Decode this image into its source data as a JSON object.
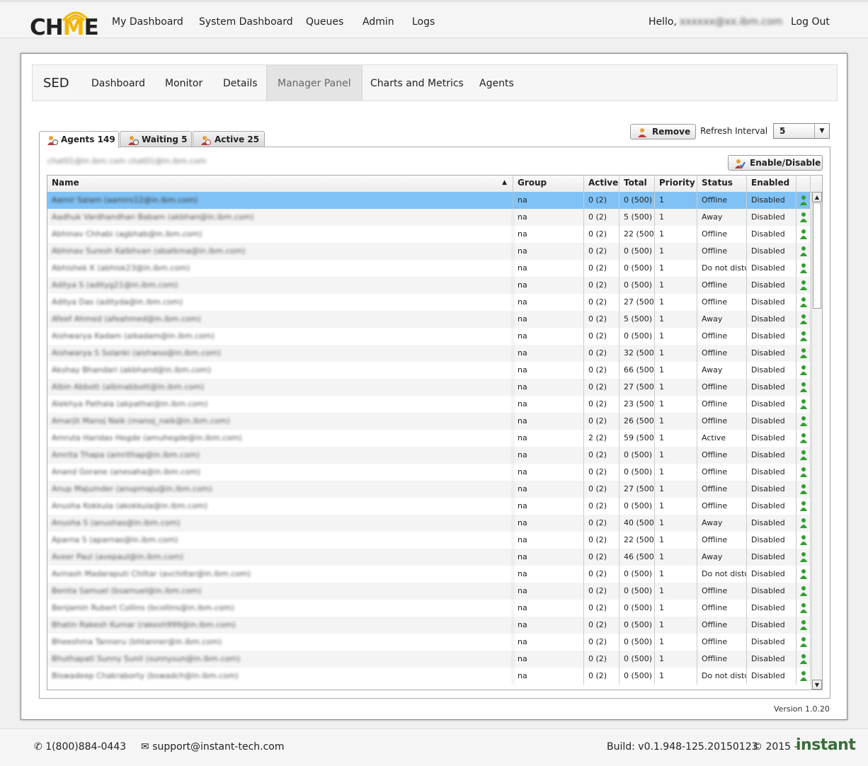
{
  "app": {
    "logo_text_pre": "CH",
    "logo_text_m": "M",
    "logo_text_post": "E"
  },
  "topnav": {
    "items": [
      "My Dashboard",
      "System Dashboard",
      "Queues",
      "Admin",
      "Logs"
    ],
    "hello": "Hello,",
    "user": "xxxxxx@xx.ibm.com",
    "logout": "Log Out"
  },
  "subnav": {
    "brand": "SED",
    "items": [
      "Dashboard",
      "Monitor",
      "Details",
      "Manager Panel",
      "Charts and Metrics",
      "Agents"
    ],
    "active": "Manager Panel"
  },
  "tabs": [
    {
      "label": "Agents 149",
      "icon": "agent-icon"
    },
    {
      "label": "Waiting 5",
      "icon": "waiting-icon"
    },
    {
      "label": "Active 25",
      "icon": "active-icon"
    }
  ],
  "toolbar": {
    "remove": "Remove",
    "refresh_label": "Refresh Interval",
    "refresh_value": "5",
    "enable_disable": "Enable/Disable"
  },
  "emails_line": "chat01@in.ibm.com chat01@in.ibm.com",
  "table": {
    "columns": [
      "Name",
      "Group",
      "Active",
      "Total",
      "Priority",
      "Status",
      "Enabled"
    ],
    "rows": [
      [
        "Aamir Salam (aamirs12@in.ibm.com)",
        "na",
        "0 (2)",
        "0 (500)",
        "1",
        "Offline",
        "Disabled"
      ],
      [
        "Aadhuk Vardhandhan Babam (akbhan@in.ibm.com)",
        "na",
        "0 (2)",
        "5 (500)",
        "1",
        "Away",
        "Disabled"
      ],
      [
        "Abhinav Chhabi (agbhab@in.ibm.com)",
        "na",
        "0 (2)",
        "22 (500)",
        "1",
        "Offline",
        "Disabled"
      ],
      [
        "Abhinav Suresh Kalbhvan (abatkma@in.ibm.com)",
        "na",
        "0 (2)",
        "0 (500)",
        "1",
        "Offline",
        "Disabled"
      ],
      [
        "Abhishek K (abhisk23@in.ibm.com)",
        "na",
        "0 (2)",
        "0 (500)",
        "1",
        "Do not distu",
        "Disabled"
      ],
      [
        "Aditya S (adityg21@in.ibm.com)",
        "na",
        "0 (2)",
        "0 (500)",
        "1",
        "Offline",
        "Disabled"
      ],
      [
        "Aditya Das (adityda@in.ibm.com)",
        "na",
        "0 (2)",
        "27 (500)",
        "1",
        "Offline",
        "Disabled"
      ],
      [
        "Afeef Ahmed (afeahmed@in.ibm.com)",
        "na",
        "0 (2)",
        "5 (500)",
        "1",
        "Away",
        "Disabled"
      ],
      [
        "Aishwarya Kadam (aikadam@in.ibm.com)",
        "na",
        "0 (2)",
        "0 (500)",
        "1",
        "Offline",
        "Disabled"
      ],
      [
        "Aishwarya S Solanki (aishwso@in.ibm.com)",
        "na",
        "0 (2)",
        "32 (500",
        "1",
        "Offline",
        "Disabled"
      ],
      [
        "Akshay Bhandari (akbhand@in.ibm.com)",
        "na",
        "0 (2)",
        "66 (500",
        "1",
        "Away",
        "Disabled"
      ],
      [
        "Albin Abbott (albinabbott@in.ibm.com)",
        "na",
        "0 (2)",
        "27 (500)",
        "1",
        "Offline",
        "Disabled"
      ],
      [
        "Alekhya Pathala (akpathal@in.ibm.com)",
        "na",
        "0 (2)",
        "23 (500",
        "1",
        "Offline",
        "Disabled"
      ],
      [
        "Amarjit Manoj Naik (manoj_naik@in.ibm.com)",
        "na",
        "0 (2)",
        "26 (500",
        "1",
        "Offline",
        "Disabled"
      ],
      [
        "Amruta Haridas Hegde (amuhegde@in.ibm.com)",
        "na",
        "2 (2)",
        "59 (500",
        "1",
        "Active",
        "Disabled"
      ],
      [
        "Amrita Thapa (amrithap@in.ibm.com)",
        "na",
        "0 (2)",
        "0 (500)",
        "1",
        "Offline",
        "Disabled"
      ],
      [
        "Anand Gorane (anesaha@in.ibm.com)",
        "na",
        "0 (2)",
        "0 (500)",
        "1",
        "Offline",
        "Disabled"
      ],
      [
        "Anup Majumder (anupmaju@in.ibm.com)",
        "na",
        "0 (2)",
        "27 (500)",
        "1",
        "Offline",
        "Disabled"
      ],
      [
        "Anusha Kokkula (akokkula@in.ibm.com)",
        "na",
        "0 (2)",
        "0 (500)",
        "1",
        "Offline",
        "Disabled"
      ],
      [
        "Anusha S (anushas@in.ibm.com)",
        "na",
        "0 (2)",
        "40 (500",
        "1",
        "Away",
        "Disabled"
      ],
      [
        "Aparna S (aparnas@in.ibm.com)",
        "na",
        "0 (2)",
        "22 (500",
        "1",
        "Offline",
        "Disabled"
      ],
      [
        "Aveer Paul (avepaul@in.ibm.com)",
        "na",
        "0 (2)",
        "46 (500",
        "1",
        "Away",
        "Disabled"
      ],
      [
        "Avinash Madaraputi Chiltar (avchiltar@in.ibm.com)",
        "na",
        "0 (2)",
        "0 (500)",
        "1",
        "Do not distu",
        "Disabled"
      ],
      [
        "Benita Samuel (bsamuel@in.ibm.com)",
        "na",
        "0 (2)",
        "0 (500)",
        "1",
        "Offline",
        "Disabled"
      ],
      [
        "Benjamin Rubert Collins (bcollins@in.ibm.com)",
        "na",
        "0 (2)",
        "0 (500)",
        "1",
        "Offline",
        "Disabled"
      ],
      [
        "Bhatin Rakesh Kumar (rakesh999@in.ibm.com)",
        "na",
        "0 (2)",
        "0 (500)",
        "1",
        "Offline",
        "Disabled"
      ],
      [
        "Bheeshma Tanneru (bhtanner@in.ibm.com)",
        "na",
        "0 (2)",
        "0 (500)",
        "1",
        "Offline",
        "Disabled"
      ],
      [
        "Bhuthapati Sunny Sunil (sunnysun@in.ibm.com)",
        "na",
        "0 (2)",
        "0 (500)",
        "1",
        "Offline",
        "Disabled"
      ],
      [
        "Biswadeep Chakraborty (bswadch@in.ibm.com)",
        "na",
        "0 (2)",
        "0 (500)",
        "1",
        "Do not distu",
        "Disabled"
      ]
    ],
    "selected_row": 0,
    "sort_indicator": "▲"
  },
  "version": "Version 1.0.20",
  "footer": {
    "phone": "1(800)884-0443",
    "email": "support@instant-tech.com",
    "build": "Build: v0.1.948-125.20150123",
    "copyright": "© 2015 -",
    "brand": "instant"
  },
  "colors": {
    "accent": "#f2b600",
    "selected_row": "#80c2f5",
    "agent_icon": "#2fa02f"
  }
}
